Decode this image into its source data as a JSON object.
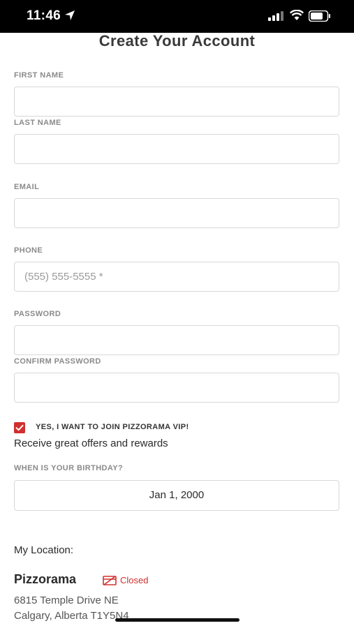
{
  "status_bar": {
    "time": "11:46"
  },
  "page": {
    "title": "Create Your Account"
  },
  "form": {
    "first_name_label": "FIRST NAME",
    "last_name_label": "LAST NAME",
    "email_label": "EMAIL",
    "phone_label": "PHONE",
    "phone_placeholder": "(555) 555-5555 *",
    "password_label": "PASSWORD",
    "confirm_password_label": "CONFIRM PASSWORD",
    "vip_checkbox_label": "YES, I WANT TO JOIN PIZZORAMA VIP!",
    "vip_checked": true,
    "vip_subtext": "Receive great offers and rewards",
    "birthday_label": "WHEN IS YOUR BIRTHDAY?",
    "birthday_value": "Jan 1, 2000"
  },
  "location": {
    "heading": "My Location:",
    "store_name": "Pizzorama",
    "status": "Closed",
    "address_line1": "6815 Temple Drive NE",
    "address_line2": "Calgary, Alberta T1Y5N4"
  },
  "colors": {
    "accent": "#d0302f",
    "label": "#8a8a8a",
    "border": "#d8d8d8"
  },
  "icons": [
    "location-arrow-icon",
    "cellular-signal-icon",
    "wifi-icon",
    "battery-icon",
    "checkmark-icon",
    "store-closed-icon"
  ]
}
